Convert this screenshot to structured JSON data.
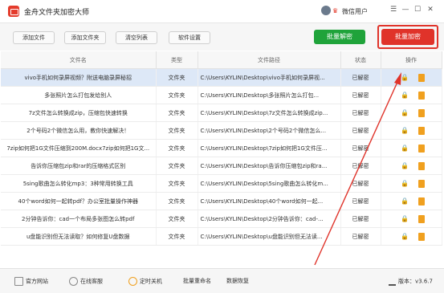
{
  "app": {
    "title": "金舟文件夹加密大师",
    "user": "微信用户"
  },
  "toolbar": {
    "buttons": [
      "添加文件",
      "添加文件夹",
      "清空列表",
      "软件设置"
    ],
    "batch_decrypt": "批量解密",
    "batch_encrypt": "批量加密"
  },
  "table": {
    "headers": [
      "文件名",
      "类型",
      "文件路径",
      "状态",
      "操作"
    ],
    "rows": [
      {
        "name": "vivo手机如何录屏视频？附送电脑录屏秘招",
        "type": "文件夹",
        "path": "C:\\Users\\KYLIN\\Desktop\\vivo手机如何录屏视...",
        "status": "已解密"
      },
      {
        "name": "多张照片怎么打包发给别人",
        "type": "文件夹",
        "path": "C:\\Users\\KYLIN\\Desktop\\多张照片怎么打包...",
        "status": "已解密"
      },
      {
        "name": "7z文件怎么转换成zip，压缩包快速转换",
        "type": "文件夹",
        "path": "C:\\Users\\KYLIN\\Desktop\\7z文件怎么转换成zip...",
        "status": "已解密"
      },
      {
        "name": "2个号码2个微信怎么用，教你快速解决！",
        "type": "文件夹",
        "path": "C:\\Users\\KYLIN\\Desktop\\2个号码2个微信怎么...",
        "status": "已解密"
      },
      {
        "name": "7zip如何把1G文件压缩到200M.docx7zip如何把1G文...",
        "type": "文件夹",
        "path": "C:\\Users\\KYLIN\\Desktop\\7zip如何把1G文件压...",
        "status": "已解密"
      },
      {
        "name": "告诉你压缩包zip和rar的压缩格式区别",
        "type": "文件夹",
        "path": "C:\\Users\\KYLIN\\Desktop\\告诉你压缩包zip和ra...",
        "status": "已解密"
      },
      {
        "name": "5sing歌曲怎么转化mp3：3种常用转换工具",
        "type": "文件夹",
        "path": "C:\\Users\\KYLIN\\Desktop\\5sing歌曲怎么转化m...",
        "status": "已解密"
      },
      {
        "name": "40个word如何一起转pdf？办公室批量操作神器",
        "type": "文件夹",
        "path": "C:\\Users\\KYLIN\\Desktop\\40个word如何一起...",
        "status": "已解密"
      },
      {
        "name": "2分钟告诉你：cad一个布局多张图怎么转pdf",
        "type": "文件夹",
        "path": "C:\\Users\\KYLIN\\Desktop\\2分钟告诉你：cad-...",
        "status": "已解密"
      },
      {
        "name": "u盘能识别但无法读取？如何修复U盘数据",
        "type": "文件夹",
        "path": "C:\\Users\\KYLIN\\Desktop\\u盘能识别但无法读...",
        "status": "已解密"
      }
    ]
  },
  "footer": {
    "items": [
      "官方网站",
      "在线客服",
      "定时关机",
      "批量重命名",
      "数据恢复"
    ],
    "version": "版本：v3.6.7"
  },
  "colors": {
    "green": "#1fa33a",
    "red": "#e0332a",
    "selected": "#dde8f7",
    "trash": "#f0a01f"
  }
}
